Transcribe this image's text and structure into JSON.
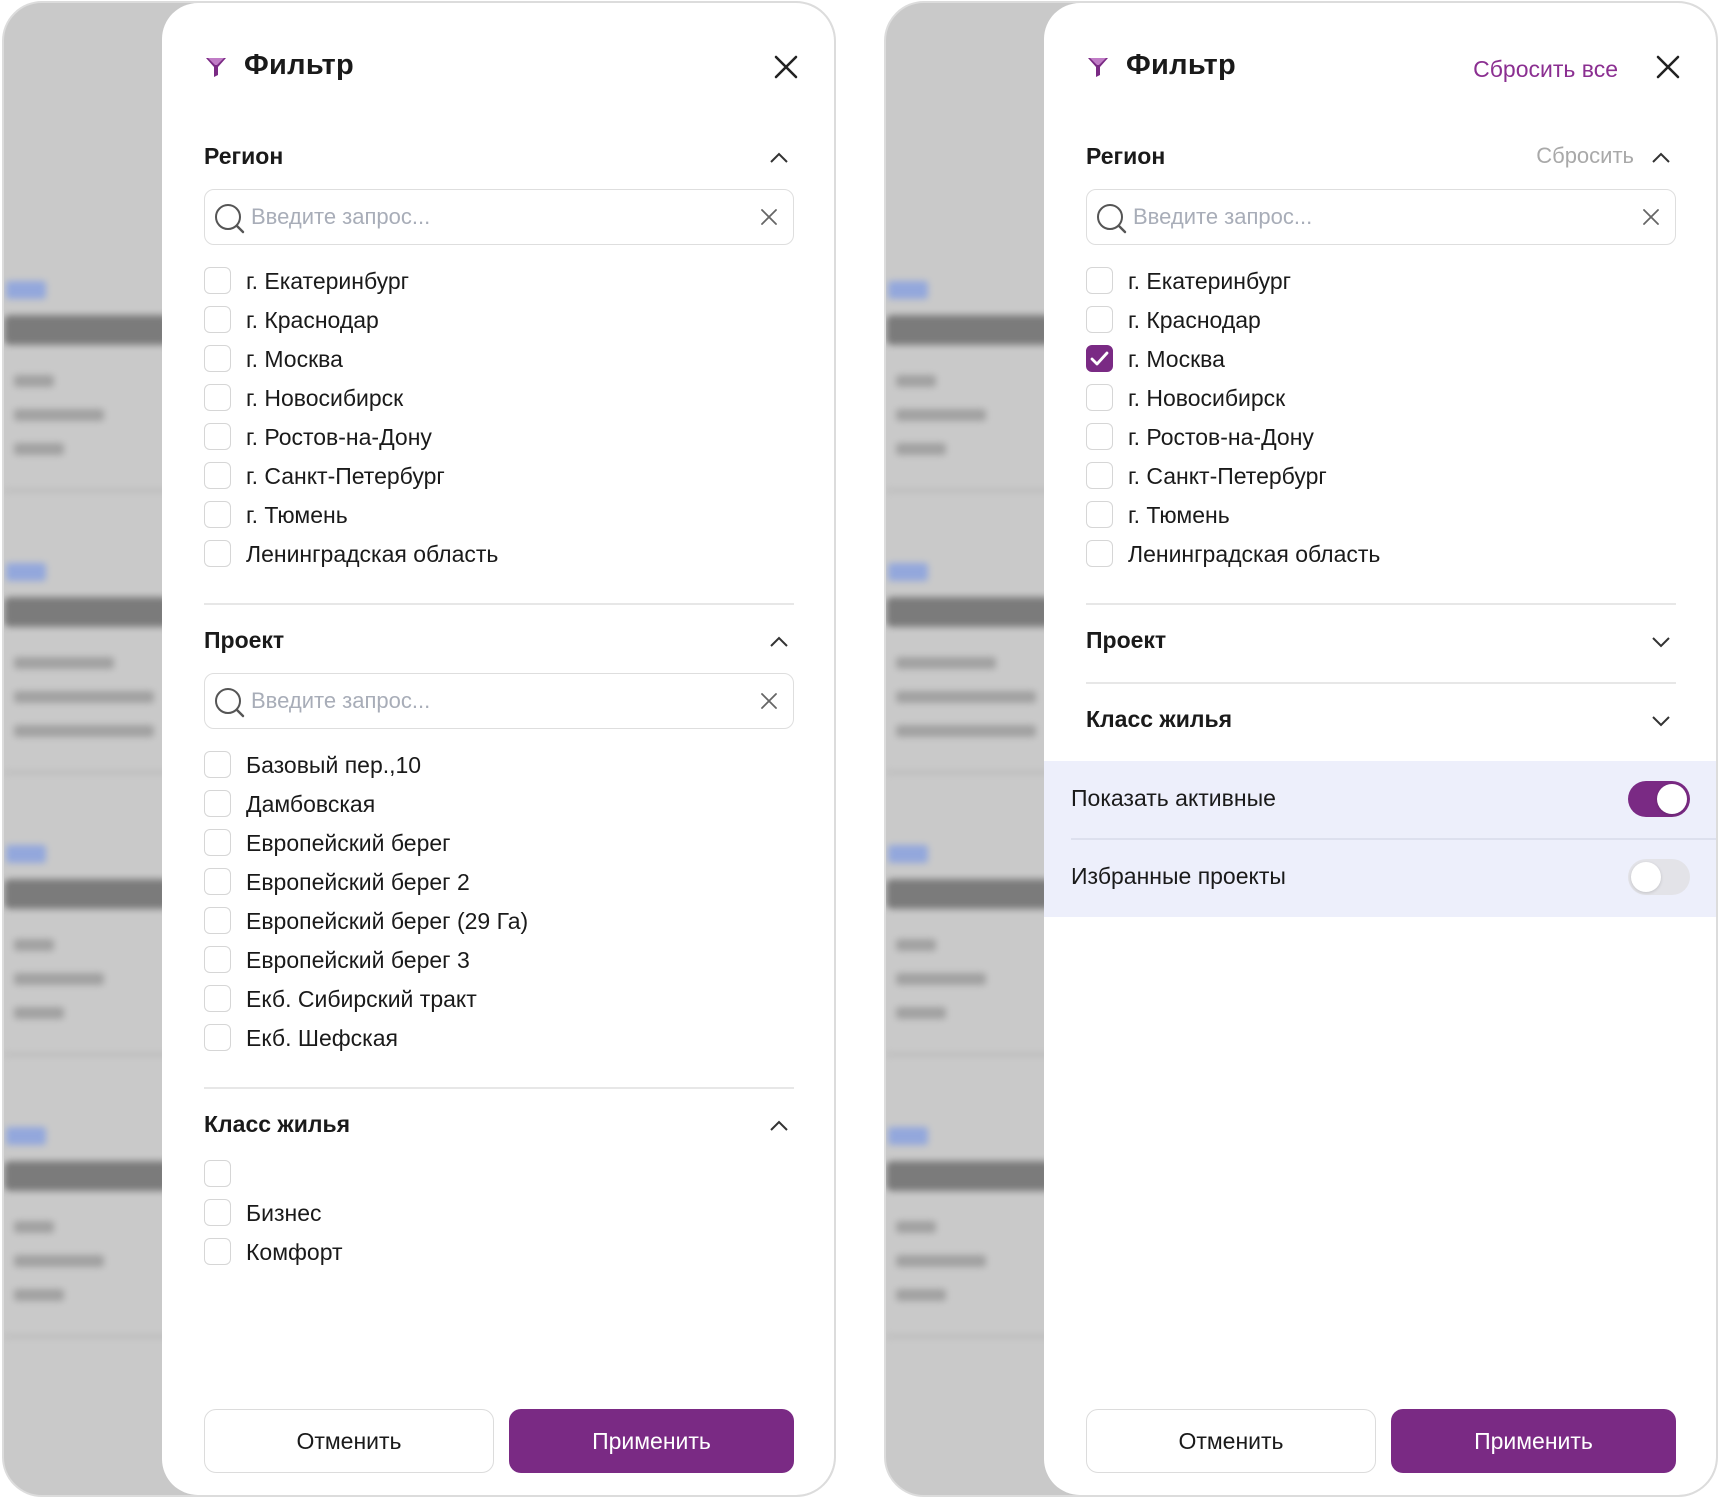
{
  "filter": {
    "title": "Фильтр",
    "reset_all": "Сбросить все",
    "section_reset": "Сбросить",
    "search_placeholder": "Введите запрос...",
    "cancel": "Отменить",
    "apply": "Применить"
  },
  "sections": {
    "region": "Регион",
    "project": "Проект",
    "class": "Класс жилья"
  },
  "regions": [
    "г. Екатеринбург",
    "г. Краснодар",
    "г. Москва",
    "г. Новосибирск",
    "г. Ростов-на-Дону",
    "г. Санкт-Петербург",
    "г. Тюмень",
    "Ленинградская область"
  ],
  "projects": [
    "Базовый пер.,10",
    "Дамбовская",
    "Европейский берег",
    "Европейский берег 2",
    "Европейский берег (29 Га)",
    "Европейский берег 3",
    "Екб. Сибирский тракт",
    "Екб. Шефская"
  ],
  "classes": [
    "",
    "Бизнес",
    "Комфорт"
  ],
  "toggles": {
    "show_active": "Показать активные",
    "favorites": "Избранные проекты"
  },
  "state": {
    "right_checked_region": "г. Москва",
    "show_active_on": true,
    "favorites_on": false
  },
  "colors": {
    "accent": "#7a2a84",
    "toggle_area_bg": "#edeffb"
  },
  "icons": [
    "funnel-icon",
    "close-icon",
    "chevron-up-icon",
    "chevron-down-icon",
    "search-icon",
    "clear-icon",
    "check-icon"
  ]
}
